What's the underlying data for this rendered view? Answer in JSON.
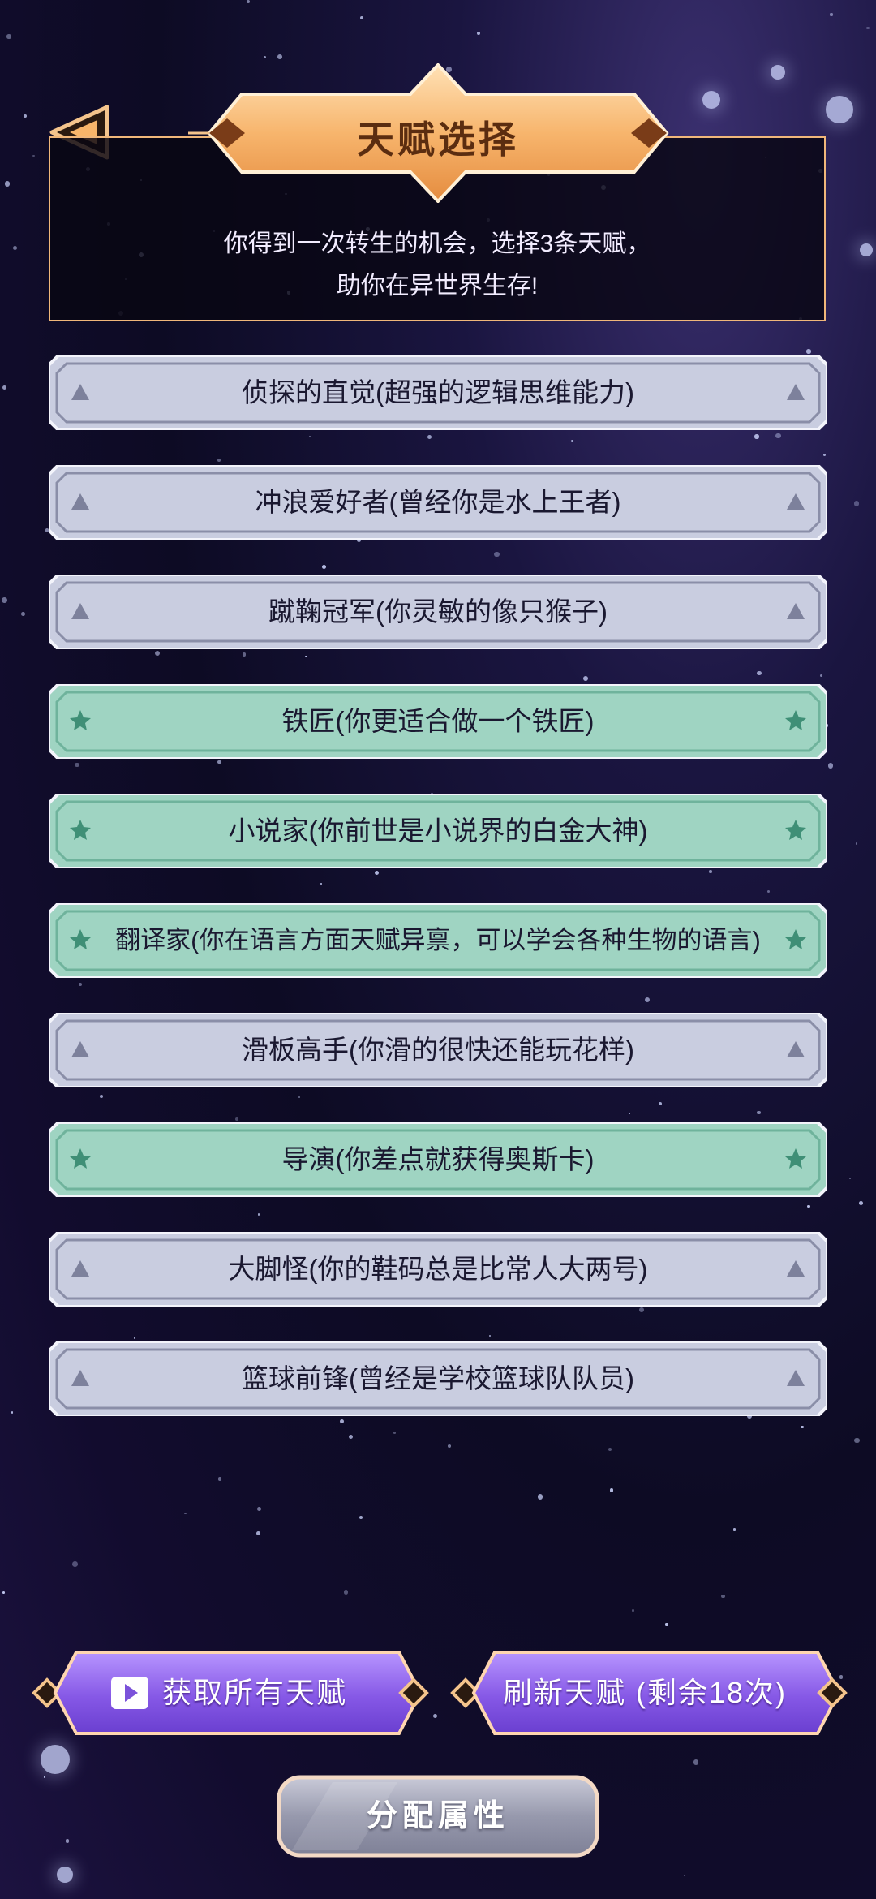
{
  "header": {
    "title": "天赋选择",
    "description_line1": "你得到一次转生的机会，选择3条天赋，",
    "description_line2": "助你在异世界生存!"
  },
  "talents": [
    {
      "label": "侦探的直觉(超强的逻辑思维能力)",
      "selected": false
    },
    {
      "label": "冲浪爱好者(曾经你是水上王者)",
      "selected": false
    },
    {
      "label": "蹴鞠冠军(你灵敏的像只猴子)",
      "selected": false
    },
    {
      "label": "铁匠(你更适合做一个铁匠)",
      "selected": true
    },
    {
      "label": "小说家(你前世是小说界的白金大神)",
      "selected": true
    },
    {
      "label": "翻译家(你在语言方面天赋异禀，可以学会各种生物的语言)",
      "selected": true
    },
    {
      "label": "滑板高手(你滑的很快还能玩花样)",
      "selected": false
    },
    {
      "label": "导演(你差点就获得奥斯卡)",
      "selected": true
    },
    {
      "label": "大脚怪(你的鞋码总是比常人大两号)",
      "selected": false
    },
    {
      "label": "篮球前锋(曾经是学校篮球队队员)",
      "selected": false
    }
  ],
  "buttons": {
    "get_all": "获取所有天赋",
    "refresh": "刷新天赋 (剩余18次)",
    "assign": "分配属性"
  },
  "icons": {
    "back": "back-arrow-icon",
    "video": "video-play-icon",
    "unselected_marker": "triangle-icon",
    "selected_marker": "star-icon"
  },
  "colors": {
    "unselected_fill": "#c9cde0",
    "selected_fill": "#9fd4c2",
    "title_gold": "#f6b873",
    "button_purple": "#8b62e6"
  }
}
